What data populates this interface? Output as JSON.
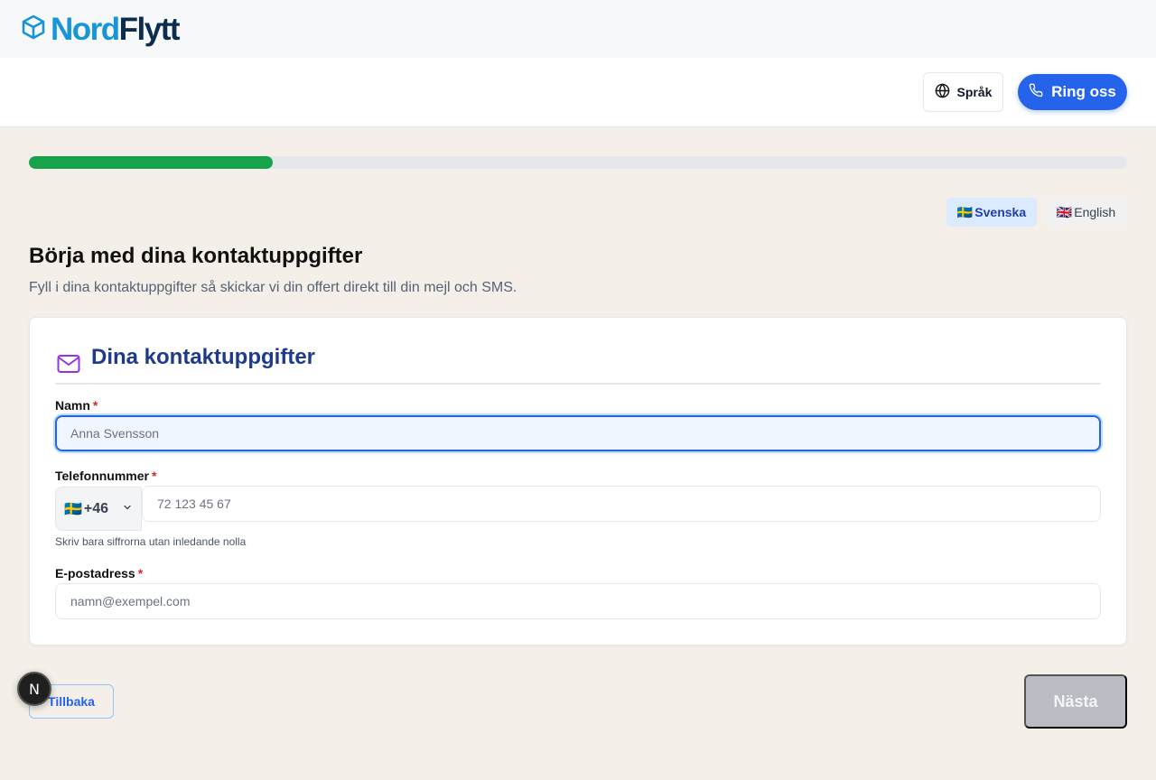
{
  "brand": {
    "part1": "Nord",
    "part2": "Flytt",
    "icon": "box-icon",
    "colors": {
      "part1": "#1795d6",
      "part2": "#0c2d4e"
    }
  },
  "header": {
    "language_button": {
      "label": "Språk",
      "icon": "globe-icon"
    },
    "call_button": {
      "label": "Ring oss",
      "icon": "phone-icon"
    }
  },
  "progress": {
    "fraction": 0.222
  },
  "language_toggle": {
    "swedish": {
      "flag": "🇸🇪",
      "label": "Svenska",
      "active": true
    },
    "english": {
      "flag": "🇬🇧",
      "label": "English",
      "active": false
    }
  },
  "page": {
    "title": "Börja med dina kontaktuppgifter",
    "subtitle": "Fyll i dina kontaktuppgifter så skickar vi din offert direkt till din mejl och SMS."
  },
  "form": {
    "section_title": "Dina kontaktuppgifter",
    "section_icon": "mail-icon",
    "required_marker": "*",
    "name": {
      "label": "Namn",
      "placeholder": "Anna Svensson",
      "value": ""
    },
    "phone": {
      "label": "Telefonnummer",
      "country_flag": "🇸🇪",
      "country_code": "+46",
      "placeholder": "72 123 45 67",
      "value": "",
      "hint": "Skriv bara siffrorna utan inledande nolla"
    },
    "email": {
      "label": "E-postadress",
      "placeholder": "namn@exempel.com",
      "value": ""
    }
  },
  "navigation": {
    "back_label": "Tillbaka",
    "next_label": "Nästa",
    "next_disabled": true
  },
  "dev_badge": {
    "letter": "N"
  },
  "colors": {
    "primary": "#2563eb",
    "progress": "#16a34a",
    "background": "#f4f0e9",
    "required": "#dc2626",
    "section_title": "#1e3a8a",
    "mail_icon": "#9333ea"
  }
}
